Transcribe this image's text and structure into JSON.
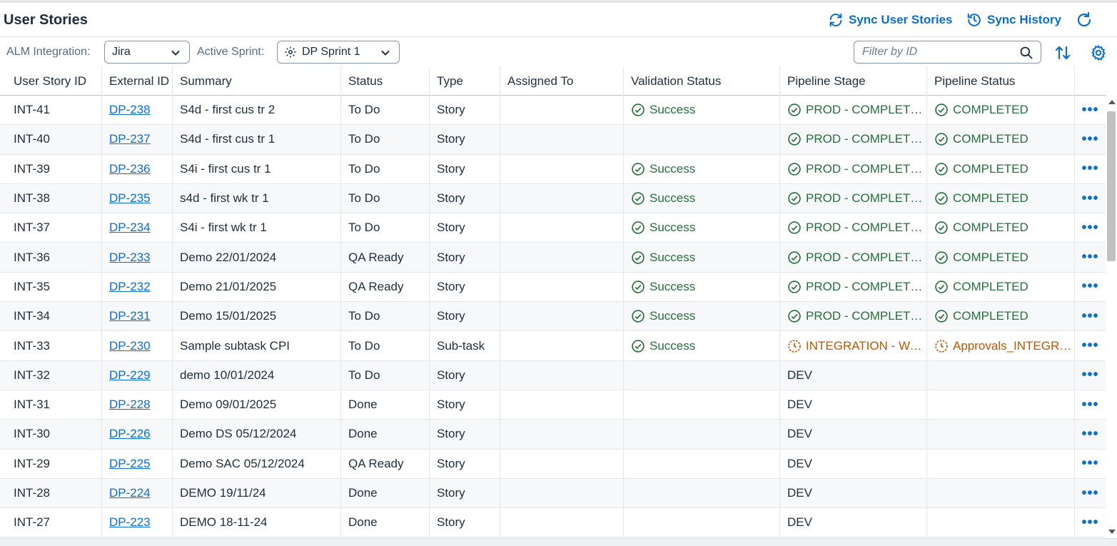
{
  "header": {
    "title": "User Stories",
    "sync_label": "Sync User Stories",
    "history_label": "Sync History"
  },
  "toolbar": {
    "alm_label": "ALM Integration:",
    "alm_value": "Jira",
    "sprint_label": "Active Sprint:",
    "sprint_value": "DP Sprint 1",
    "filter_placeholder": "Filter by ID"
  },
  "columns": [
    "User Story ID",
    "External ID",
    "Summary",
    "Status",
    "Type",
    "Assigned To",
    "Validation Status",
    "Pipeline Stage",
    "Pipeline Status"
  ],
  "colors": {
    "accent": "#0a6ed1",
    "success": "#256f3a",
    "warning": "#c35500"
  },
  "rows": [
    {
      "id": "INT-41",
      "ext": "DP-238",
      "summary": "S4d - first cus tr 2",
      "status": "To Do",
      "type": "Story",
      "assigned": "",
      "validation": "Success",
      "stage": "PROD - COMPLETED",
      "stage_state": "success",
      "pstatus": "COMPLETED",
      "pstatus_state": "success"
    },
    {
      "id": "INT-40",
      "ext": "DP-237",
      "summary": "S4d - first cus tr 1",
      "status": "To Do",
      "type": "Story",
      "assigned": "",
      "validation": "",
      "stage": "PROD - COMPLETED",
      "stage_state": "success",
      "pstatus": "COMPLETED",
      "pstatus_state": "success"
    },
    {
      "id": "INT-39",
      "ext": "DP-236",
      "summary": "S4i - first cus tr 1",
      "status": "To Do",
      "type": "Story",
      "assigned": "",
      "validation": "Success",
      "stage": "PROD - COMPLETED",
      "stage_state": "success",
      "pstatus": "COMPLETED",
      "pstatus_state": "success"
    },
    {
      "id": "INT-38",
      "ext": "DP-235",
      "summary": "s4d - first wk tr 1",
      "status": "To Do",
      "type": "Story",
      "assigned": "",
      "validation": "Success",
      "stage": "PROD - COMPLETED",
      "stage_state": "success",
      "pstatus": "COMPLETED",
      "pstatus_state": "success"
    },
    {
      "id": "INT-37",
      "ext": "DP-234",
      "summary": "S4i - first wk tr 1",
      "status": "To Do",
      "type": "Story",
      "assigned": "",
      "validation": "Success",
      "stage": "PROD - COMPLETED",
      "stage_state": "success",
      "pstatus": "COMPLETED",
      "pstatus_state": "success"
    },
    {
      "id": "INT-36",
      "ext": "DP-233",
      "summary": "Demo 22/01/2024",
      "status": "QA Ready",
      "type": "Story",
      "assigned": "",
      "validation": "Success",
      "stage": "PROD - COMPLETED",
      "stage_state": "success",
      "pstatus": "COMPLETED",
      "pstatus_state": "success"
    },
    {
      "id": "INT-35",
      "ext": "DP-232",
      "summary": "Demo 21/01/2025",
      "status": "QA Ready",
      "type": "Story",
      "assigned": "",
      "validation": "Success",
      "stage": "PROD - COMPLETED",
      "stage_state": "success",
      "pstatus": "COMPLETED",
      "pstatus_state": "success"
    },
    {
      "id": "INT-34",
      "ext": "DP-231",
      "summary": "Demo 15/01/2025",
      "status": "To Do",
      "type": "Story",
      "assigned": "",
      "validation": "Success",
      "stage": "PROD - COMPLETED",
      "stage_state": "success",
      "pstatus": "COMPLETED",
      "pstatus_state": "success"
    },
    {
      "id": "INT-33",
      "ext": "DP-230",
      "summary": "Sample subtask CPI",
      "status": "To Do",
      "type": "Sub-task",
      "assigned": "",
      "validation": "Success",
      "stage": "INTEGRATION - WAITING",
      "stage_state": "warn",
      "pstatus": "Approvals_INTEGRATION",
      "pstatus_state": "warn"
    },
    {
      "id": "INT-32",
      "ext": "DP-229",
      "summary": "demo 10/01/2024",
      "status": "To Do",
      "type": "Story",
      "assigned": "",
      "validation": "",
      "stage": "DEV",
      "stage_state": "plain",
      "pstatus": "",
      "pstatus_state": "plain"
    },
    {
      "id": "INT-31",
      "ext": "DP-228",
      "summary": "Demo 09/01/2025",
      "status": "Done",
      "type": "Story",
      "assigned": "",
      "validation": "",
      "stage": "DEV",
      "stage_state": "plain",
      "pstatus": "",
      "pstatus_state": "plain"
    },
    {
      "id": "INT-30",
      "ext": "DP-226",
      "summary": "Demo DS 05/12/2024",
      "status": "Done",
      "type": "Story",
      "assigned": "",
      "validation": "",
      "stage": "DEV",
      "stage_state": "plain",
      "pstatus": "",
      "pstatus_state": "plain"
    },
    {
      "id": "INT-29",
      "ext": "DP-225",
      "summary": "Demo SAC 05/12/2024",
      "status": "QA Ready",
      "type": "Story",
      "assigned": "",
      "validation": "",
      "stage": "DEV",
      "stage_state": "plain",
      "pstatus": "",
      "pstatus_state": "plain"
    },
    {
      "id": "INT-28",
      "ext": "DP-224",
      "summary": "DEMO 19/11/24",
      "status": "Done",
      "type": "Story",
      "assigned": "",
      "validation": "",
      "stage": "DEV",
      "stage_state": "plain",
      "pstatus": "",
      "pstatus_state": "plain"
    },
    {
      "id": "INT-27",
      "ext": "DP-223",
      "summary": "DEMO 18-11-24",
      "status": "Done",
      "type": "Story",
      "assigned": "",
      "validation": "",
      "stage": "DEV",
      "stage_state": "plain",
      "pstatus": "",
      "pstatus_state": "plain"
    }
  ]
}
